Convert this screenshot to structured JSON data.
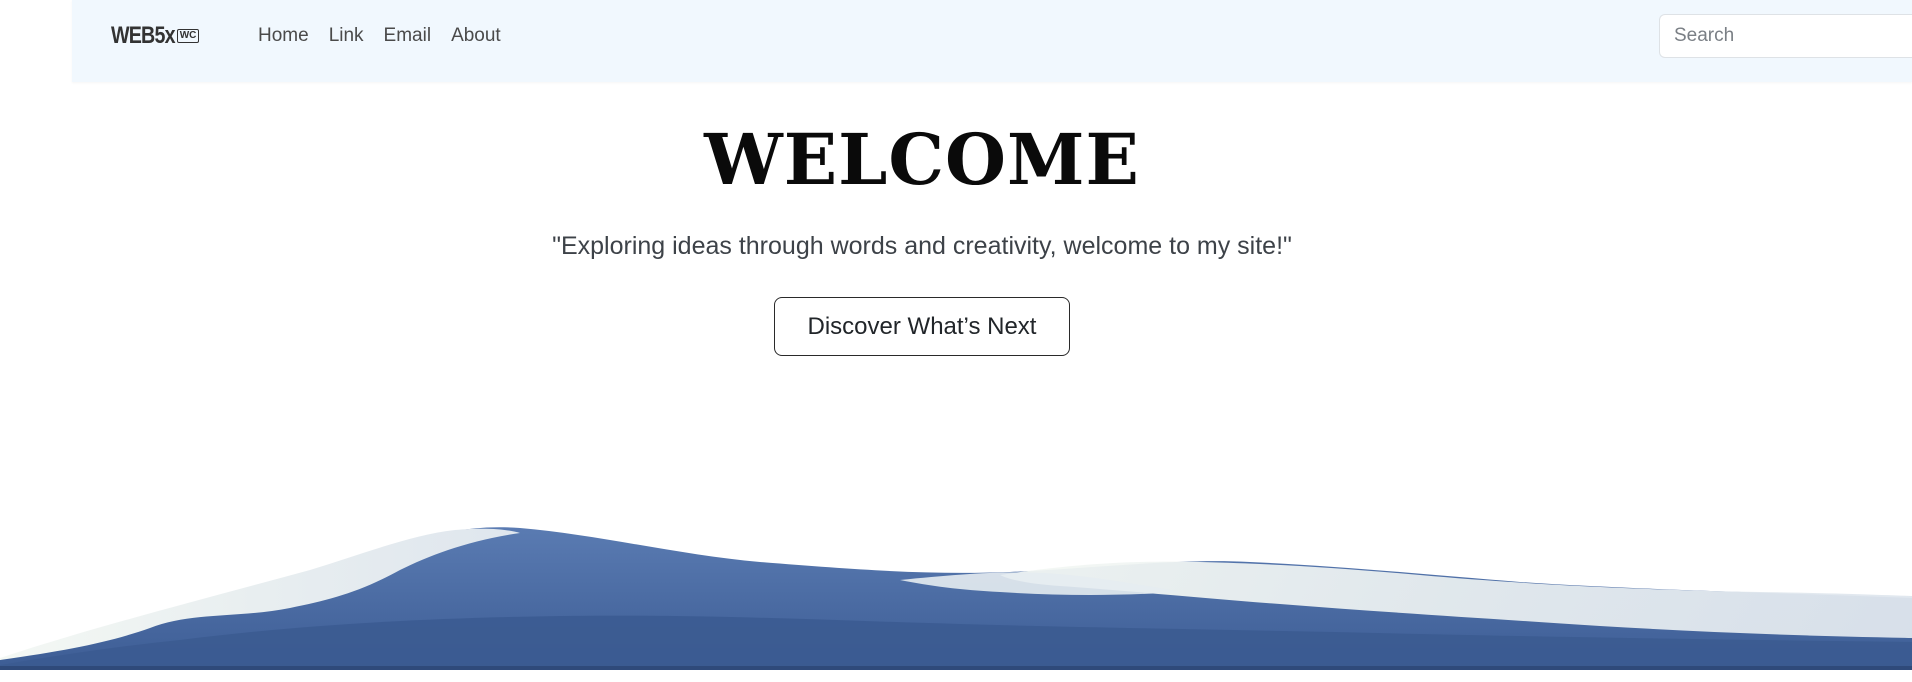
{
  "navbar": {
    "brand": "WEB5x",
    "brand_badge": "WC",
    "links": [
      "Home",
      "Link",
      "Email",
      "About"
    ],
    "search_placeholder": "Search",
    "search_value": ""
  },
  "hero": {
    "title": "WELCOME",
    "subtitle": "\"Exploring ideas through words and creativity, welcome to my site!\"",
    "cta_label": "Discover What’s Next"
  },
  "colors": {
    "navbar_bg": "#f1f8fe",
    "mountain_blue": "#4a6aa0",
    "mountain_snow": "#eef3f2"
  },
  "icons": {
    "mountains": "snowy-mountain-landscape"
  }
}
